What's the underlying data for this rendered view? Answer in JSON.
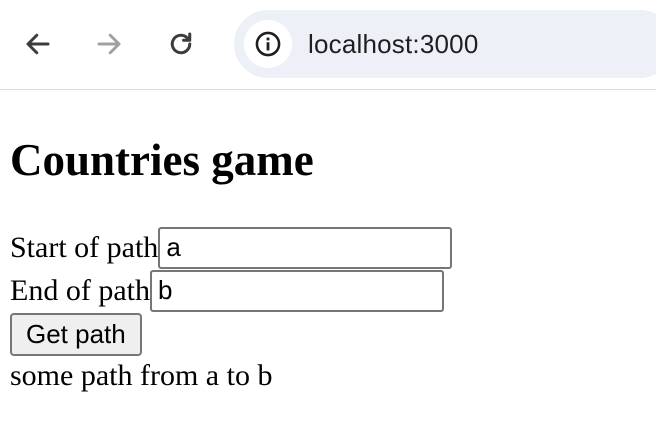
{
  "browser": {
    "url": "localhost:3000",
    "icons": {
      "back": "arrow-left-icon",
      "forward": "arrow-right-icon",
      "reload": "reload-icon",
      "site_info": "info-icon"
    },
    "forward_enabled": false
  },
  "page": {
    "title": "Countries game",
    "start_label": "Start of path",
    "start_value": "a",
    "end_label": "End of path",
    "end_value": "b",
    "button_label": "Get path",
    "result": "some path from a to b"
  }
}
